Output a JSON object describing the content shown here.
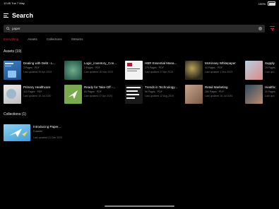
{
  "status": {
    "time": "12:45",
    "date": "Tue 7 May",
    "battery": "100%"
  },
  "header": {
    "title": "Search"
  },
  "search": {
    "value": "paper"
  },
  "tabs": [
    "Everything",
    "Assets",
    "Collections",
    "Streams"
  ],
  "assets_label": "Assets (19)",
  "collections_label": "Collections (1)",
  "assets": [
    {
      "name": "Dealing with Debt - L...",
      "meta": "3 Pages · PDF",
      "updated": "Last updated 26 Apr 2024"
    },
    {
      "name": "Logic_inventory_Con...",
      "meta": "2 Pages · PDF",
      "updated": "Last updated 16 Nov 2023"
    },
    {
      "name": "HBR Essential Mana...",
      "meta": "279 Pages · PDF",
      "updated": "Last updated 27 Apr 2024"
    },
    {
      "name": "McKinsey Whitepaper",
      "meta": "44 Pages · PDF",
      "updated": "Last updated 1 Nov 2023"
    },
    {
      "name": "Supply",
      "meta": "29 Pages",
      "updated": "Last upd"
    },
    {
      "name": "Primary Healthcare",
      "meta": "114 Pages · PDF",
      "updated": "Last updated 16 Jul 2020"
    },
    {
      "name": "Ready for Take-Off -...",
      "meta": "80 Pages · PDF",
      "updated": "Last updated 27 Apr 2024"
    },
    {
      "name": "Trends in Technology...",
      "meta": "96 Pages · PDF",
      "updated": "Last updated 12 Aug 2019"
    },
    {
      "name": "Retail Marketing",
      "meta": "280 Pages · PDF",
      "updated": "Last updated 16 Jul 2020"
    },
    {
      "name": "Healthc",
      "meta": "20 Pages",
      "updated": "Last upd"
    }
  ],
  "collections": [
    {
      "name": "Introducing Paper...",
      "meta": "5 assets",
      "updated": "Last updated 21 Dec 2023"
    }
  ]
}
